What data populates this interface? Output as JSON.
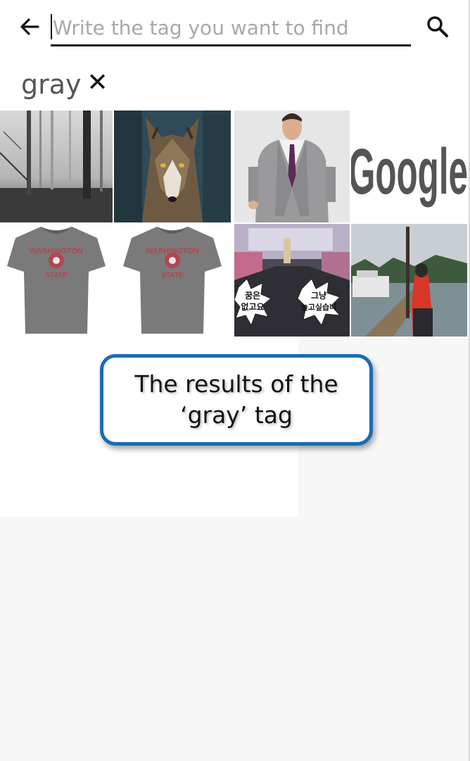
{
  "search": {
    "placeholder": "Write the tag you want to find",
    "value": ""
  },
  "tag": {
    "label": "gray",
    "remove_glyph": "✕"
  },
  "results": [
    {
      "name": "forest-image",
      "subject": "foggy gray forest"
    },
    {
      "name": "wolf-image",
      "subject": "gray wolf"
    },
    {
      "name": "suit-image",
      "subject": "man in gray suit"
    },
    {
      "name": "google-logo-image",
      "subject": "gray Google logo",
      "text": "Google"
    },
    {
      "name": "tshirt-image-1",
      "subject": "gray Washington State t-shirt",
      "text_top": "WASHINGTON",
      "text_bottom": "STATE"
    },
    {
      "name": "tshirt-image-2",
      "subject": "gray Washington State t-shirt",
      "text_top": "WASHINGTON",
      "text_bottom": "STATE"
    },
    {
      "name": "tv-show-image",
      "subject": "TV show stage with captions",
      "caption_left_1": "꿈은",
      "caption_left_2": "없고요",
      "caption_right_1": "그냥",
      "caption_right_2": "놀고싶습니"
    },
    {
      "name": "dock-image",
      "subject": "person on a gray dock by the lake"
    }
  ],
  "callout": {
    "line1": "The results of the",
    "line2": "‘gray’ tag"
  },
  "icons": {
    "back": "back-arrow-icon",
    "search": "search-icon",
    "close": "close-icon"
  },
  "colors": {
    "callout_border": "#1a6bb3",
    "tshirt_print": "#b0474f"
  }
}
